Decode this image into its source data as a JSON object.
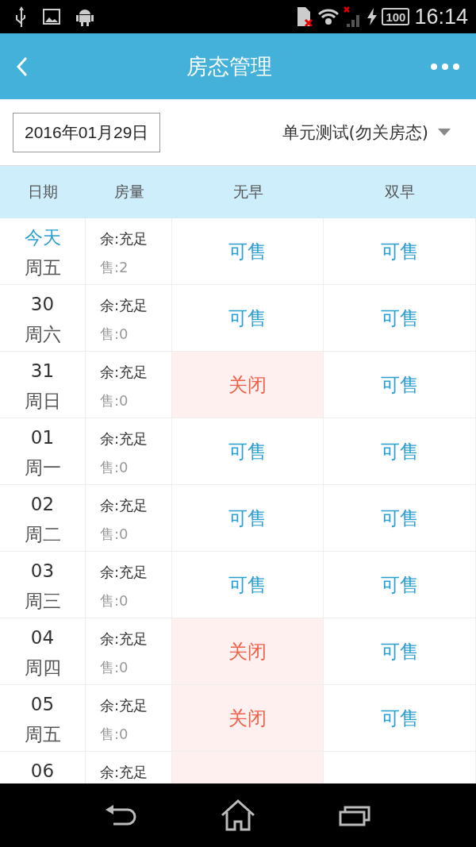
{
  "status_bar": {
    "time": "16:14",
    "battery": "100"
  },
  "header": {
    "title": "房态管理"
  },
  "filter": {
    "date": "2016年01月29日",
    "room_type": "单元测试(勿关房态)"
  },
  "table": {
    "columns": [
      "日期",
      "房量",
      "无早",
      "双早"
    ],
    "rows": [
      {
        "day": "今天",
        "today": true,
        "weekday": "周五",
        "remaining": "余:充足",
        "sold": "售:2",
        "statuses": [
          {
            "label": "可售",
            "kind": "open"
          },
          {
            "label": "可售",
            "kind": "open"
          }
        ]
      },
      {
        "day": "30",
        "today": false,
        "weekday": "周六",
        "remaining": "余:充足",
        "sold": "售:0",
        "statuses": [
          {
            "label": "可售",
            "kind": "open"
          },
          {
            "label": "可售",
            "kind": "open"
          }
        ]
      },
      {
        "day": "31",
        "today": false,
        "weekday": "周日",
        "remaining": "余:充足",
        "sold": "售:0",
        "statuses": [
          {
            "label": "关闭",
            "kind": "closed"
          },
          {
            "label": "可售",
            "kind": "open"
          }
        ]
      },
      {
        "day": "01",
        "today": false,
        "weekday": "周一",
        "remaining": "余:充足",
        "sold": "售:0",
        "statuses": [
          {
            "label": "可售",
            "kind": "open"
          },
          {
            "label": "可售",
            "kind": "open"
          }
        ]
      },
      {
        "day": "02",
        "today": false,
        "weekday": "周二",
        "remaining": "余:充足",
        "sold": "售:0",
        "statuses": [
          {
            "label": "可售",
            "kind": "open"
          },
          {
            "label": "可售",
            "kind": "open"
          }
        ]
      },
      {
        "day": "03",
        "today": false,
        "weekday": "周三",
        "remaining": "余:充足",
        "sold": "售:0",
        "statuses": [
          {
            "label": "可售",
            "kind": "open"
          },
          {
            "label": "可售",
            "kind": "open"
          }
        ]
      },
      {
        "day": "04",
        "today": false,
        "weekday": "周四",
        "remaining": "余:充足",
        "sold": "售:0",
        "statuses": [
          {
            "label": "关闭",
            "kind": "closed"
          },
          {
            "label": "可售",
            "kind": "open"
          }
        ]
      },
      {
        "day": "05",
        "today": false,
        "weekday": "周五",
        "remaining": "余:充足",
        "sold": "售:0",
        "statuses": [
          {
            "label": "关闭",
            "kind": "closed"
          },
          {
            "label": "可售",
            "kind": "open"
          }
        ]
      },
      {
        "day": "06",
        "today": false,
        "remaining": "余:充足",
        "statuses": [
          {
            "kind": "closed"
          },
          {
            "kind": "open"
          }
        ]
      }
    ]
  }
}
